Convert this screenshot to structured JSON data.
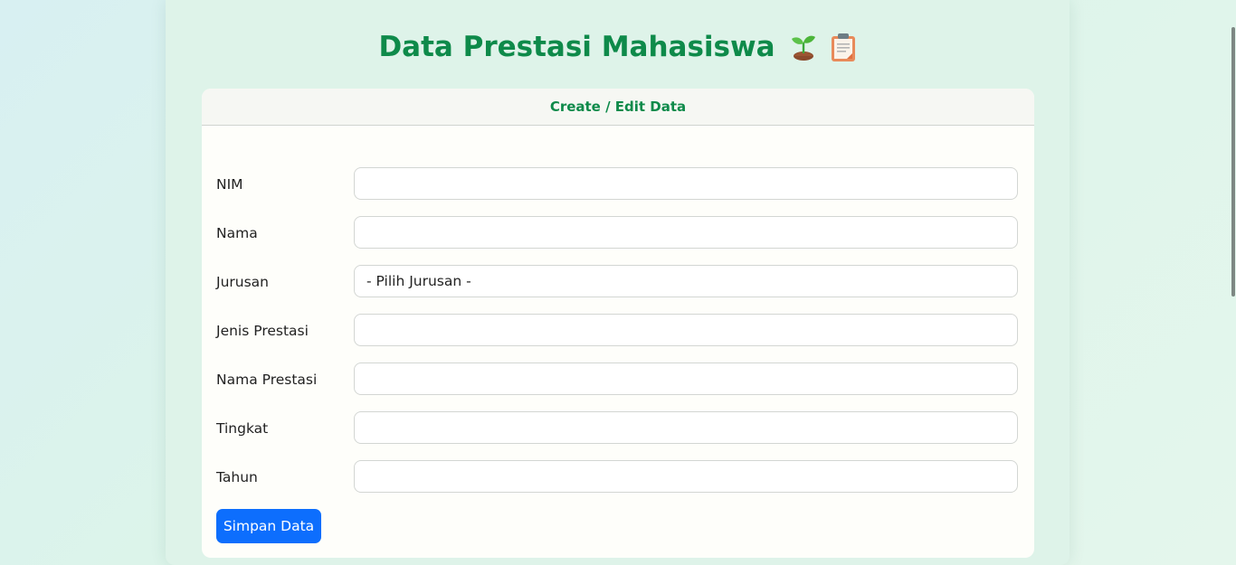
{
  "header": {
    "title": "Data Prestasi Mahasiswa",
    "icons": [
      "seedling-icon",
      "clipboard-icon"
    ]
  },
  "card": {
    "title": "Create / Edit Data"
  },
  "form": {
    "fields": [
      {
        "label": "NIM",
        "value": ""
      },
      {
        "label": "Nama",
        "value": ""
      },
      {
        "label": "Jurusan",
        "value": "- Pilih Jurusan -"
      },
      {
        "label": "Jenis Prestasi",
        "value": ""
      },
      {
        "label": "Nama Prestasi",
        "value": ""
      },
      {
        "label": "Tingkat",
        "value": ""
      },
      {
        "label": "Tahun",
        "value": ""
      }
    ],
    "submit_label": "Simpan Data"
  },
  "colors": {
    "accent_green": "#0e8a4a",
    "button_blue": "#0d6efd"
  }
}
